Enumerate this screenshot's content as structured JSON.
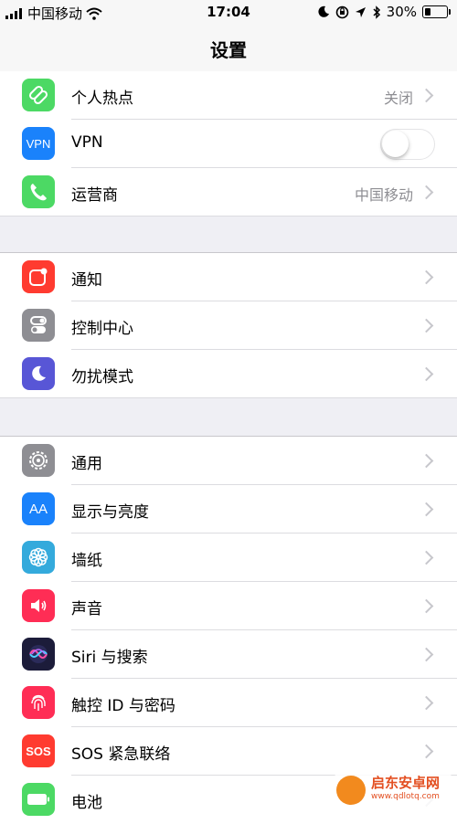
{
  "status_bar": {
    "carrier": "中国移动",
    "time": "17:04",
    "battery_percent": "30%",
    "battery_level": 0.3,
    "icons": [
      "signal-icon",
      "wifi-icon",
      "moon-icon",
      "orientation-lock-icon",
      "location-arrow-icon",
      "bluetooth-icon",
      "battery-icon"
    ]
  },
  "nav": {
    "title": "设置"
  },
  "groups": [
    {
      "rows": [
        {
          "label": "个人热点",
          "value": "关闭",
          "icon": "hotspot-icon",
          "color": "#4cd964"
        },
        {
          "label": "VPN",
          "icon": "vpn-icon",
          "icon_text": "VPN",
          "color": "#1a82fb",
          "toggle": false
        },
        {
          "label": "运营商",
          "value": "中国移动",
          "icon": "phone-icon",
          "color": "#4cd964"
        }
      ]
    },
    {
      "rows": [
        {
          "label": "通知",
          "icon": "notifications-icon",
          "color": "#ff3b30"
        },
        {
          "label": "控制中心",
          "icon": "control-center-icon",
          "color": "#8e8e93"
        },
        {
          "label": "勿扰模式",
          "icon": "moon-icon",
          "color": "#5856d6"
        }
      ]
    },
    {
      "rows": [
        {
          "label": "通用",
          "icon": "gear-icon",
          "color": "#8e8e93"
        },
        {
          "label": "显示与亮度",
          "icon": "display-icon",
          "icon_text": "AA",
          "color": "#1a82fb"
        },
        {
          "label": "墙纸",
          "icon": "wallpaper-icon",
          "color": "#34aadc"
        },
        {
          "label": "声音",
          "icon": "speaker-icon",
          "color": "#ff2d55"
        },
        {
          "label": "Siri 与搜索",
          "icon": "siri-icon",
          "color": "#1c1c3a"
        },
        {
          "label": "触控 ID 与密码",
          "icon": "fingerprint-icon",
          "color": "#ff2d55"
        },
        {
          "label": "SOS 紧急联络",
          "icon": "sos-icon",
          "icon_text": "SOS",
          "color": "#ff3b30"
        },
        {
          "label": "电池",
          "icon": "battery-icon",
          "color": "#4cd964"
        }
      ]
    }
  ],
  "watermark": {
    "name": "启东安卓网",
    "url": "www.qdlotq.com"
  }
}
